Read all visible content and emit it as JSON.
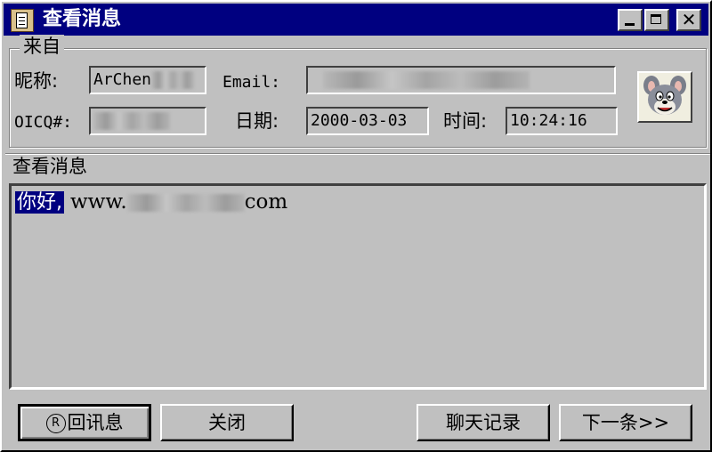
{
  "window": {
    "title": "查看消息",
    "icon": "notepad-icon"
  },
  "title_buttons": {
    "minimize": "minimize-icon",
    "maximize": "maximize-icon",
    "close_glyph": "✕"
  },
  "sender_group": {
    "label": "来自",
    "nickname_label": "昵称:",
    "nickname_value": "ArChen",
    "email_label": "Email:",
    "oicq_label": "OICQ#:",
    "date_label": "日期:",
    "date_value": "2000-03-03",
    "time_label": "时间:",
    "time_value": "10:24:16",
    "avatar": "cartoon-cat-avatar"
  },
  "message": {
    "label": "查看消息",
    "selected_text": "你好,",
    "url_prefix": "www.",
    "url_suffix": "com"
  },
  "buttons": {
    "reply_hotkey": "R",
    "reply_label": "回讯息",
    "close_label": "关闭",
    "history_label": "聊天记录",
    "next_label": "下一条>>"
  }
}
